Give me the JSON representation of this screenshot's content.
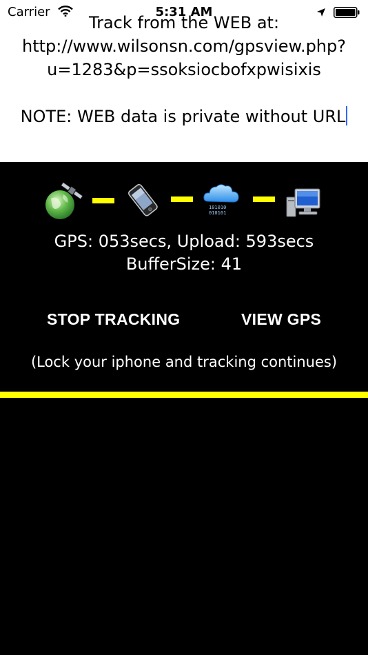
{
  "status_bar": {
    "carrier": "Carrier",
    "time": "5:31 AM",
    "icons": [
      "wifi-icon",
      "location-arrow-icon",
      "battery-icon"
    ]
  },
  "track_info": {
    "line1": "Track from the WEB at:",
    "line2": "http://www.wilsonsn.com/gpsview.php?",
    "line3": "u=1283&p=ssoksiocbofxpwisixis",
    "note": "NOTE: WEB data is private without URL"
  },
  "pipeline": {
    "icons": [
      "satellite-globe-icon",
      "phone-icon",
      "cloud-data-icon",
      "computer-icon"
    ],
    "connector_color": "#ffff00"
  },
  "stats": {
    "gps_upload": "GPS: 053secs, Upload: 593secs",
    "buffer": "BufferSize: 41"
  },
  "buttons": {
    "stop": "STOP TRACKING",
    "view": "VIEW GPS"
  },
  "lock_note": "(Lock your iphone and tracking continues)",
  "colors": {
    "background": "#000000",
    "text_panel": "#ffffff",
    "accent": "#ffff00",
    "cursor": "#2b6bf5"
  }
}
